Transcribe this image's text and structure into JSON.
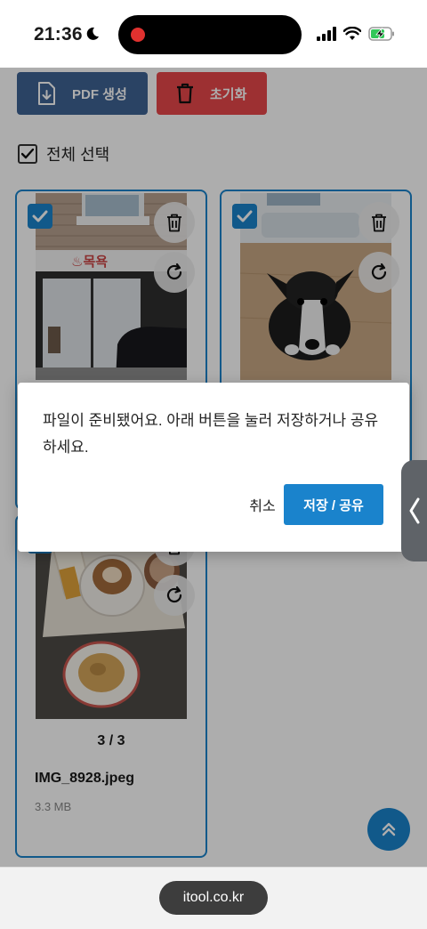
{
  "status_bar": {
    "time": "21:36"
  },
  "toolbar": {
    "pdf_label": "PDF 생성",
    "reset_label": "초기화"
  },
  "select_all": {
    "label": "전체 선택"
  },
  "cards": [
    {
      "page": "",
      "file_name": "",
      "file_size": ""
    },
    {
      "page": "",
      "file_name": "",
      "file_size": ""
    },
    {
      "page": "3 / 3",
      "file_name": "IMG_8928.jpeg",
      "file_size": "3.3 MB"
    }
  ],
  "photo_text": {
    "store_sign": "♨목욕"
  },
  "dialog": {
    "message": "파일이 준비됐어요. 아래 버튼을 눌러 저장하거나 공유하세요.",
    "cancel_label": "취소",
    "save_label": "저장 / 공유"
  },
  "browser": {
    "url": "itool.co.kr"
  },
  "colors": {
    "primary": "#1a83cc",
    "pdf_button": "#3f6394",
    "reset_button": "#e8474a"
  },
  "icons": [
    "moon-icon",
    "signal-icon",
    "wifi-icon",
    "battery-charging-icon",
    "file-download-icon",
    "trash-icon",
    "rotate-icon",
    "check-icon",
    "chevron-left-icon",
    "double-chevron-up-icon"
  ]
}
